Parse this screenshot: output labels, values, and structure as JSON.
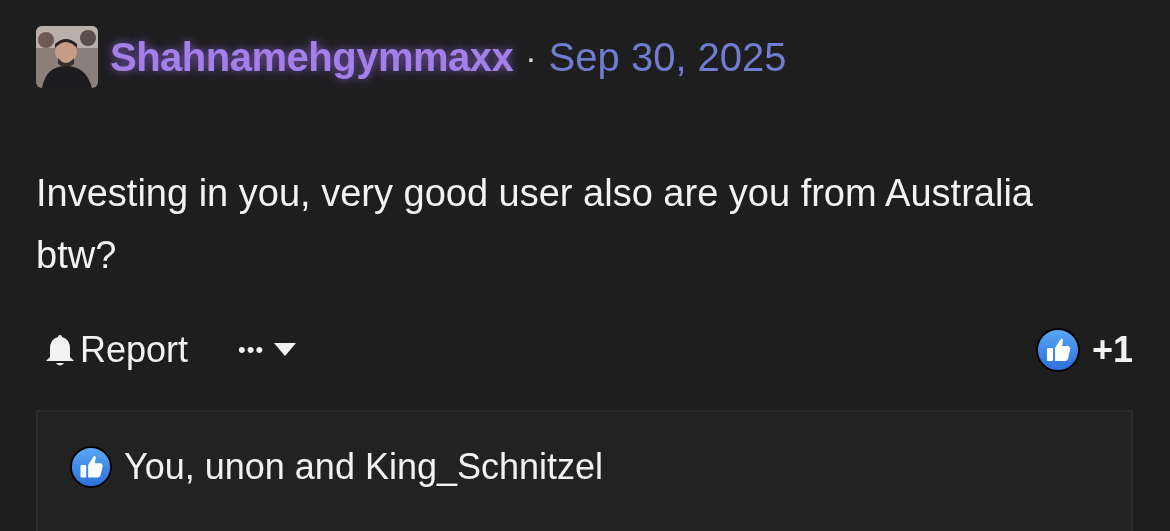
{
  "post": {
    "author": "Shahnamehgymmaxx",
    "separator": "·",
    "date": "Sep 30, 2025",
    "body": "Investing in you, very good user also are you from Australia btw?"
  },
  "actions": {
    "report": "Report",
    "more": "•••",
    "like_count": "+1"
  },
  "reactions": {
    "text": "You, unon and King_Schnitzel"
  }
}
